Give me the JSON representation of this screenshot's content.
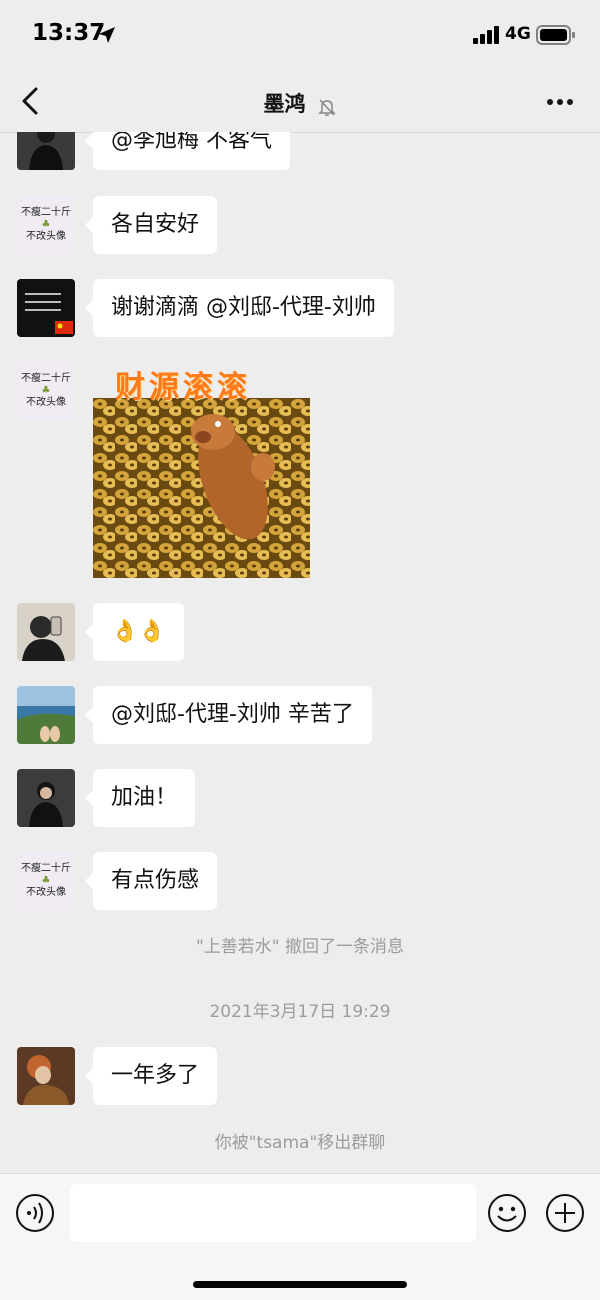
{
  "status": {
    "time": "13:37",
    "network": "4G"
  },
  "header": {
    "title": "墨鸿",
    "back_icon": "chevron-left-icon",
    "mute_icon": "bell-muted-icon",
    "more_icon": "more-dots-icon"
  },
  "avatar_text": {
    "line1": "不瘦二十斤",
    "line2": "不改头像"
  },
  "messages": [
    {
      "text": "@李旭梅 不客气"
    },
    {
      "text": "各自安好"
    },
    {
      "text": "谢谢滴滴 @刘邸-代理-刘帅"
    },
    {
      "sticker_caption": "财源滚滚"
    },
    {
      "text": "👌👌"
    },
    {
      "text": "@刘邸-代理-刘帅 辛苦了"
    },
    {
      "text": "加油！"
    },
    {
      "text": "有点伤感"
    },
    {
      "text": "一年多了"
    }
  ],
  "system": {
    "recall": "\"上善若水\" 撤回了一条消息",
    "timestamp": "2021年3月17日 19:29",
    "removed": "你被\"tsama\"移出群聊"
  },
  "inputbar": {
    "voice_icon": "voice-icon",
    "emoji_icon": "emoji-icon",
    "plus_icon": "plus-icon"
  }
}
